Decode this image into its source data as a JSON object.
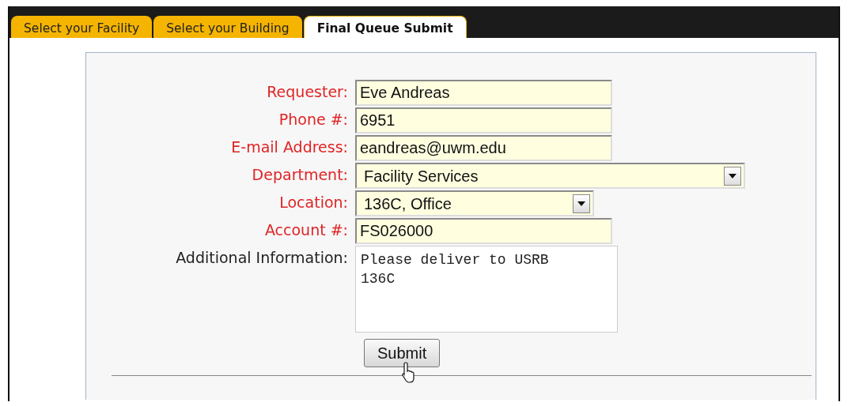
{
  "tabs": [
    {
      "label": "Select your Facility",
      "selected": false
    },
    {
      "label": "Select your Building",
      "selected": false
    },
    {
      "label": "Final Queue Submit",
      "selected": true
    }
  ],
  "form": {
    "fields": [
      {
        "kind": "text",
        "label": "Requester:",
        "required": true,
        "value": "Eve Andreas"
      },
      {
        "kind": "text",
        "label": "Phone #:",
        "required": true,
        "value": "6951"
      },
      {
        "kind": "text",
        "label": "E-mail Address:",
        "required": true,
        "value": "eandreas@uwm.edu"
      },
      {
        "kind": "select",
        "wide": true,
        "label": "Department:",
        "required": true,
        "value": "Facility Services"
      },
      {
        "kind": "select",
        "wide": false,
        "label": "Location:",
        "required": true,
        "value": "136C, Office"
      },
      {
        "kind": "text",
        "label": "Account #:",
        "required": true,
        "value": "FS026000"
      },
      {
        "kind": "textarea",
        "label": "Additional Information:",
        "required": false,
        "value": "Please deliver to USRB\n136C"
      }
    ],
    "submit": "Submit"
  }
}
